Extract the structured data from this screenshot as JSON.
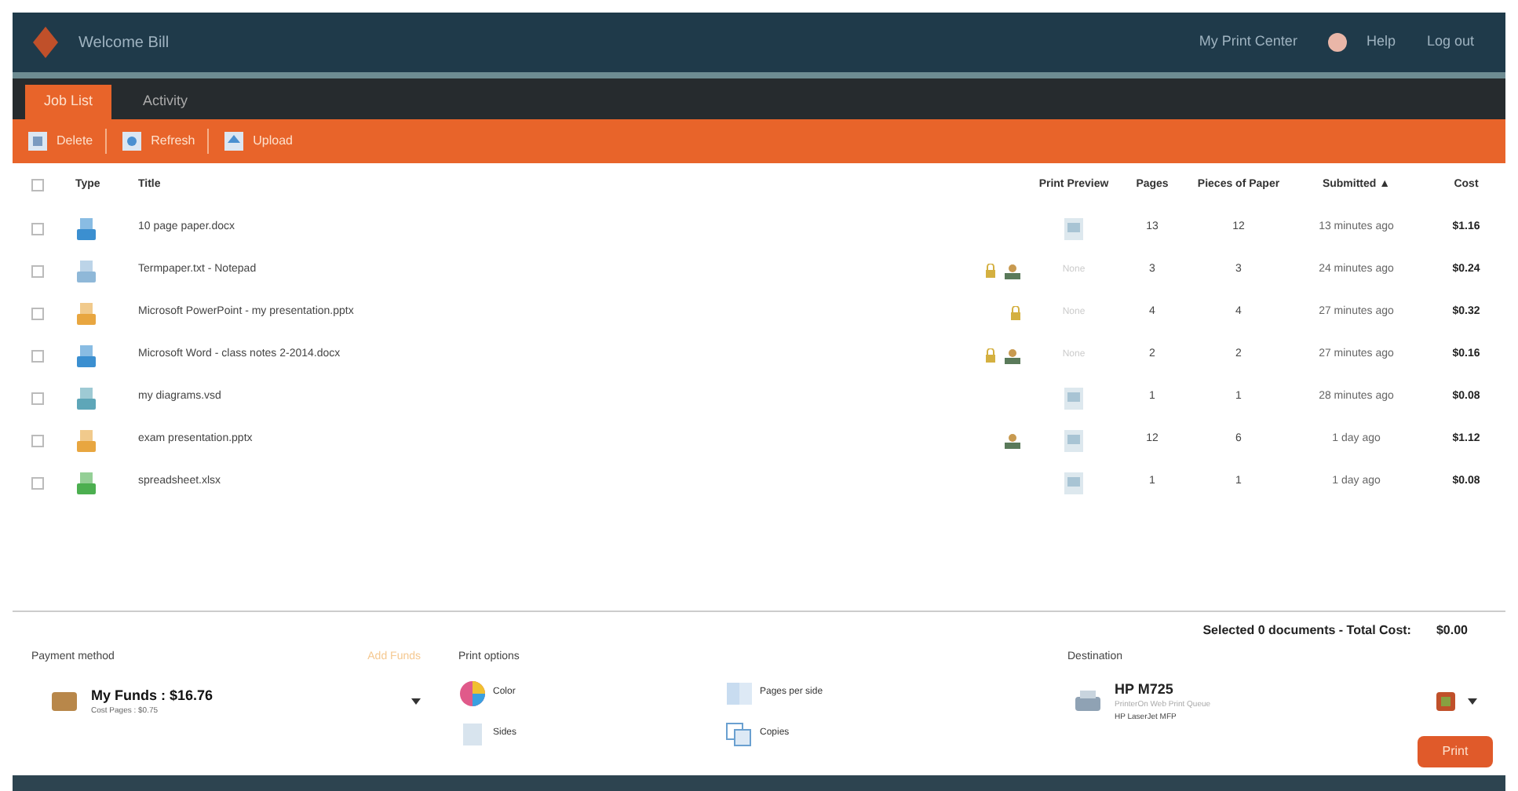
{
  "header": {
    "title": "Welcome Bill",
    "links": [
      "My Print Center",
      "Help",
      "Log out"
    ]
  },
  "tabs": [
    {
      "label": "Job List",
      "selected": true
    },
    {
      "label": "Activity",
      "selected": false
    }
  ],
  "toolbar": [
    "Delete",
    "Refresh",
    "Upload"
  ],
  "table": {
    "select_all_checked": false,
    "columns": [
      "Type",
      "Title",
      "Print Preview",
      "Pages",
      "Pieces of Paper",
      "Submitted ▲",
      "Cost"
    ],
    "rows": [
      {
        "checked": false,
        "color": "#3b8fd0",
        "title": "10 page paper.docx",
        "locked": false,
        "shared": false,
        "pages": "13",
        "pieces": "12",
        "submitted": "13 minutes ago",
        "cost": "$1.16"
      },
      {
        "checked": false,
        "color": "#8fb8d8",
        "title": "Termpaper.txt - Notepad",
        "locked": true,
        "shared": true,
        "preview": "None",
        "pages": "3",
        "pieces": "3",
        "submitted": "24 minutes ago",
        "cost": "$0.24"
      },
      {
        "checked": false,
        "color": "#e8a640",
        "title": "Microsoft PowerPoint - my presentation.pptx",
        "locked": true,
        "shared": false,
        "preview": "None",
        "pages": "4",
        "pieces": "4",
        "submitted": "27 minutes ago",
        "cost": "$0.32"
      },
      {
        "checked": false,
        "color": "#3b8fd0",
        "title": "Microsoft Word - class notes 2-2014.docx",
        "locked": true,
        "shared": true,
        "preview": "None",
        "pages": "2",
        "pieces": "2",
        "submitted": "27 minutes ago",
        "cost": "$0.16"
      },
      {
        "checked": false,
        "color": "#5ea6b8",
        "title": "my diagrams.vsd",
        "locked": false,
        "shared": false,
        "pages": "1",
        "pieces": "1",
        "submitted": "28 minutes ago",
        "cost": "$0.08"
      },
      {
        "checked": false,
        "color": "#e8a640",
        "title": "exam presentation.pptx",
        "locked": false,
        "shared": true,
        "pages": "12",
        "pieces": "6",
        "submitted": "1 day ago",
        "cost": "$1.12"
      },
      {
        "checked": false,
        "color": "#4caf50",
        "title": "spreadsheet.xlsx",
        "locked": false,
        "shared": false,
        "pages": "1",
        "pieces": "1",
        "submitted": "1 day ago",
        "cost": "$0.08"
      }
    ]
  },
  "summary": {
    "label": "Selected 0 documents - Total Cost:",
    "total": "$0.00"
  },
  "payment": {
    "heading": "Payment method",
    "add_link": "Add Funds",
    "name": "My Funds : $16.76",
    "detail": "Cost Pages : $0.75"
  },
  "print_options": {
    "heading": "Print options",
    "items": [
      "Color",
      "Sides",
      "Pages per side",
      "Copies"
    ]
  },
  "destination": {
    "heading": "Destination",
    "printer": "HP M725",
    "queue": "PrinterOn Web Print Queue",
    "model": "HP LaserJet MFP"
  },
  "print_button": "Print"
}
